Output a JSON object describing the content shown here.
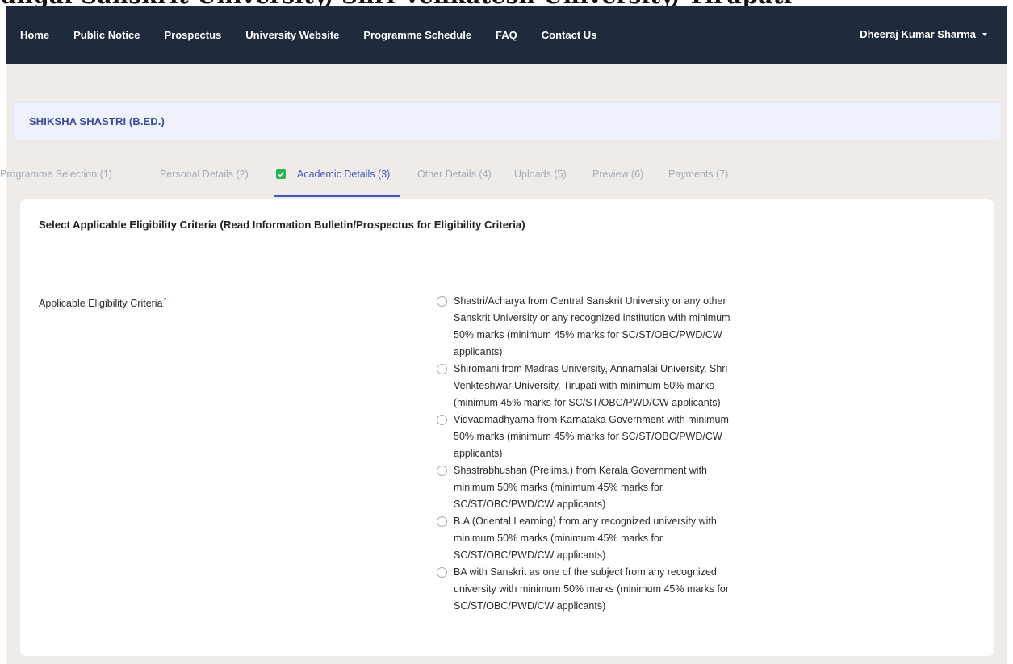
{
  "top_cut_text": "ungal Sanskrit University, Shri Venkatesh University, Tirupati",
  "nav": {
    "items": [
      "Home",
      "Public Notice",
      "Prospectus",
      "University Website",
      "Programme Schedule",
      "FAQ",
      "Contact Us"
    ],
    "user": "Dheeraj Kumar Sharma"
  },
  "programme": {
    "title": "SHIKSHA SHASTRI (B.ED.)"
  },
  "steps": [
    {
      "label": "Programme Selection (1)"
    },
    {
      "label": "Personal Details (2)"
    },
    {
      "label": "Academic Details (3)",
      "active": true
    },
    {
      "label": "Other Details (4)"
    },
    {
      "label": "Uploads (5)"
    },
    {
      "label": "Preview (6)"
    },
    {
      "label": "Payments (7)"
    }
  ],
  "form": {
    "heading": "Select Applicable Eligibility Criteria (Read Information Bulletin/Prospectus for Eligibility Criteria)",
    "field_label": "Applicable Eligibility Criteria",
    "required_mark": "*",
    "options": [
      "Shastri/Acharya from Central Sanskrit University or any other Sanskrit University or any recognized institution with minimum 50% marks (minimum 45% marks for SC/ST/OBC/PWD/CW applicants)",
      "Shiromani from Madras University, Annamalai University, Shri Venkteshwar University, Tirupati with minimum 50% marks (minimum 45% marks for SC/ST/OBC/PWD/CW applicants)",
      "Vidvadmadhyama from Karnataka Government with minimum 50% marks (minimum 45% marks for SC/ST/OBC/PWD/CW applicants)",
      "Shastrabhushan (Prelims.) from Kerala Government with minimum 50% marks (minimum 45% marks for SC/ST/OBC/PWD/CW applicants)",
      "B.A (Oriental Learning) from any recognized university with minimum 50% marks (minimum 45% marks for SC/ST/OBC/PWD/CW applicants)",
      "BA with Sanskrit as one of the subject from any recognized university with minimum 50% marks (minimum 45% marks for SC/ST/OBC/PWD/CW applicants)"
    ]
  },
  "colors": {
    "navbar_bg": "#1f2b3d",
    "accent": "#4456c7",
    "check_green": "#25b34b",
    "page_bg": "#eeebe8",
    "banner_bg": "#eff1fd"
  }
}
